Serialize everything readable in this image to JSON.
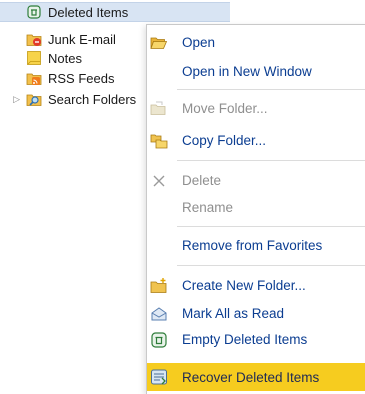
{
  "folder_tree": {
    "items": [
      {
        "label": "Deleted Items",
        "icon": "trash-can-icon",
        "selected": true
      },
      {
        "label": "Junk E-mail",
        "icon": "junk-folder-icon",
        "selected": false
      },
      {
        "label": "Notes",
        "icon": "notes-icon",
        "selected": false
      },
      {
        "label": "RSS Feeds",
        "icon": "rss-folder-icon",
        "selected": false
      },
      {
        "label": "Search Folders",
        "icon": "search-folder-icon",
        "selected": false,
        "expandable": true
      }
    ]
  },
  "context_menu": {
    "items": [
      {
        "label": "Open",
        "icon": "open-folder-icon",
        "enabled": true
      },
      {
        "label": "Open in New Window",
        "icon": "",
        "enabled": true
      },
      {
        "label": "Move Folder...",
        "icon": "move-folder-icon",
        "enabled": false
      },
      {
        "label": "Copy Folder...",
        "icon": "copy-folder-icon",
        "enabled": true
      },
      {
        "label": "Delete",
        "icon": "delete-x-icon",
        "enabled": false
      },
      {
        "label": "Rename",
        "icon": "",
        "enabled": false
      },
      {
        "label": "Remove from Favorites",
        "icon": "",
        "enabled": true
      },
      {
        "label": "Create New Folder...",
        "icon": "new-folder-icon",
        "enabled": true
      },
      {
        "label": "Mark All as Read",
        "icon": "mark-read-envelope-icon",
        "enabled": true
      },
      {
        "label": "Empty Deleted Items",
        "icon": "trash-can-icon",
        "enabled": true
      },
      {
        "label": "Recover Deleted Items",
        "icon": "recover-items-icon",
        "enabled": true,
        "highlighted": true
      }
    ]
  },
  "colors": {
    "menu_text": "#0b3d91",
    "disabled_text": "#8f8f8f",
    "highlight": "#f6cc1f",
    "selection": "#d8e4f3"
  }
}
